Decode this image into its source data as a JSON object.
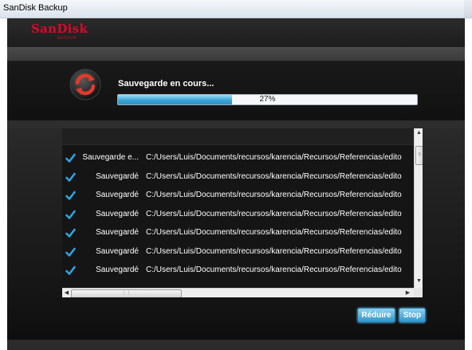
{
  "window": {
    "title": "SanDisk Backup"
  },
  "brand": {
    "logo_text": "SanDisk",
    "logo_sub": "BACKUP",
    "color": "#c8102e"
  },
  "progress": {
    "status_text": "Sauvegarde en cours...",
    "percent_label": "27%",
    "fraction": 0.27,
    "fill_color": "#3aa6d9"
  },
  "file_list": {
    "rows": [
      {
        "status": "Sauvegarde e...",
        "path": "C:/Users/Luis/Documents/recursos/karencia/Recursos/Referencias/edito"
      },
      {
        "status": "Sauvegardé",
        "path": "C:/Users/Luis/Documents/recursos/karencia/Recursos/Referencias/edito"
      },
      {
        "status": "Sauvegardé",
        "path": "C:/Users/Luis/Documents/recursos/karencia/Recursos/Referencias/edito"
      },
      {
        "status": "Sauvegardé",
        "path": "C:/Users/Luis/Documents/recursos/karencia/Recursos/Referencias/edito"
      },
      {
        "status": "Sauvegardé",
        "path": "C:/Users/Luis/Documents/recursos/karencia/Recursos/Referencias/edito"
      },
      {
        "status": "Sauvegardé",
        "path": "C:/Users/Luis/Documents/recursos/karencia/Recursos/Referencias/edito"
      },
      {
        "status": "Sauvegardé",
        "path": "C:/Users/Luis/Documents/recursos/karencia/Recursos/Referencias/edito"
      }
    ],
    "check_icon": "checkmark-icon",
    "check_color": "#2fa4e0"
  },
  "buttons": {
    "reduce_label": "Réduire",
    "stop_label": "Stop"
  }
}
